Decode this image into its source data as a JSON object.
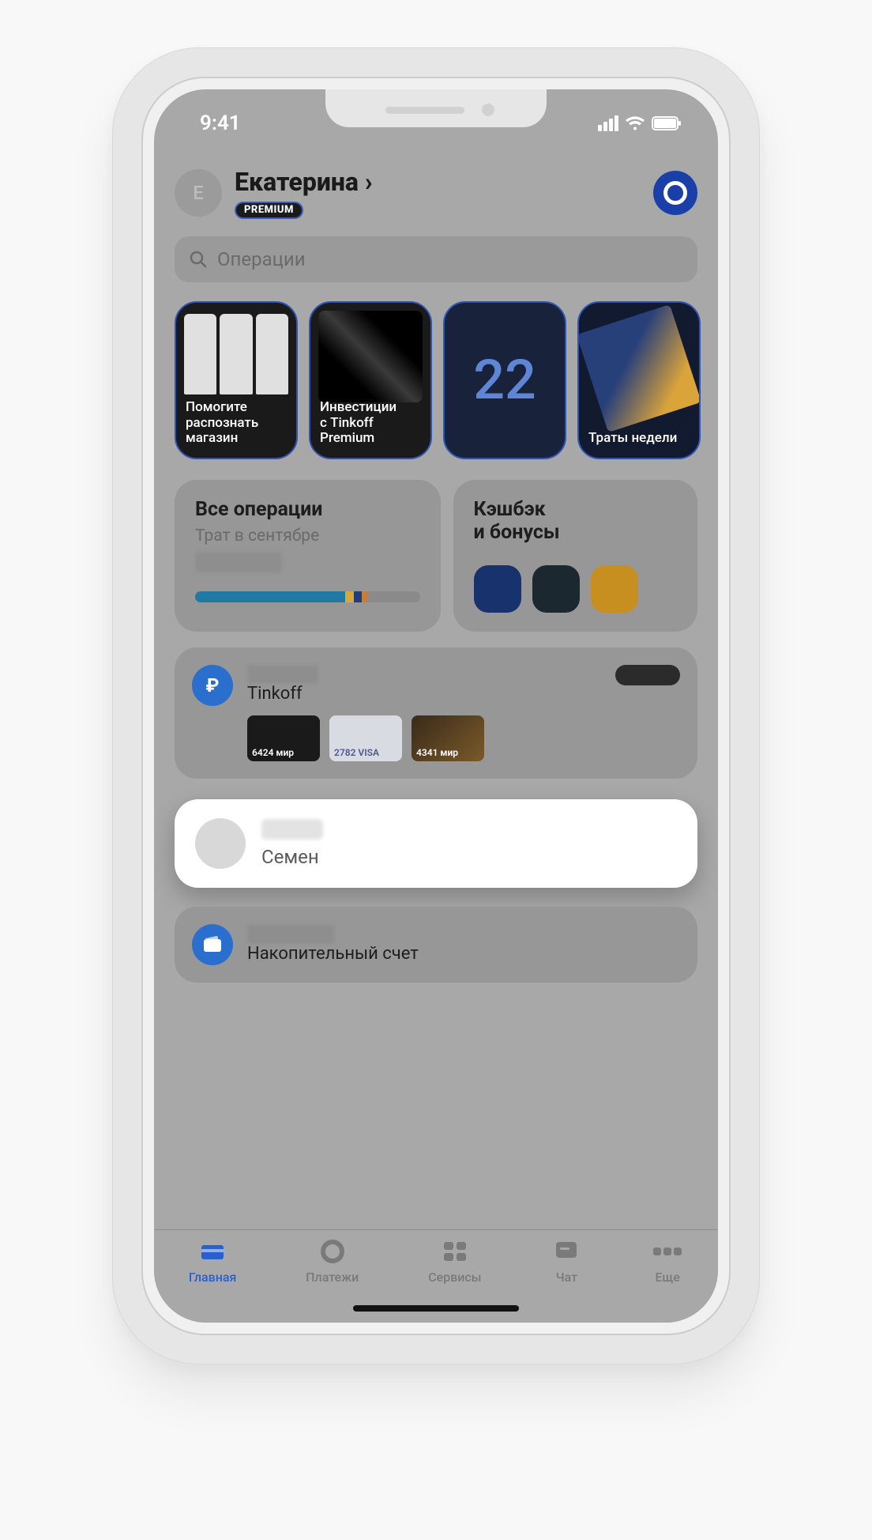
{
  "status_bar": {
    "time": "9:41"
  },
  "header": {
    "avatar_initial": "E",
    "user_name": "Екатерина ›",
    "premium_label": "PREMIUM"
  },
  "search": {
    "placeholder": "Операции"
  },
  "stories": {
    "s1_label": "Помогите\nраспознать\nмагазин",
    "s2_label": "Инвестиции\nс Tinkoff\nPremium",
    "s3_number": "22",
    "s4_label": "Траты недели"
  },
  "operations_card": {
    "title": "Все операции",
    "subtitle": "Трат в сентябре"
  },
  "cashback_card": {
    "title": "Кэшбэк\nи бонусы"
  },
  "account": {
    "bank_name": "Tinkoff",
    "cards": {
      "c1_label": "6424 мир",
      "c2_label": "2782 VISA",
      "c3_label": "4341 мир"
    }
  },
  "child_account": {
    "name": "Семен"
  },
  "savings": {
    "label": "Накопительный счет"
  },
  "tabs": {
    "home": "Главная",
    "payments": "Платежи",
    "services": "Сервисы",
    "chat": "Чат",
    "more": "Еще"
  }
}
